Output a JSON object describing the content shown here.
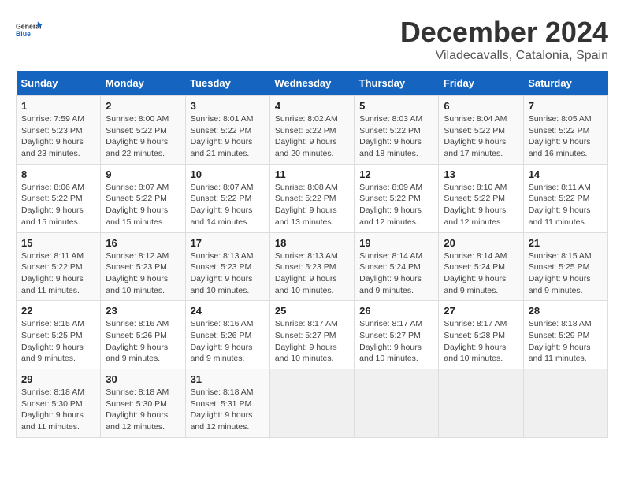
{
  "logo": {
    "line1": "General",
    "line2": "Blue"
  },
  "title": "December 2024",
  "location": "Viladecavalls, Catalonia, Spain",
  "days_of_week": [
    "Sunday",
    "Monday",
    "Tuesday",
    "Wednesday",
    "Thursday",
    "Friday",
    "Saturday"
  ],
  "weeks": [
    [
      {
        "day": "1",
        "sunrise": "Sunrise: 7:59 AM",
        "sunset": "Sunset: 5:23 PM",
        "daylight": "Daylight: 9 hours and 23 minutes."
      },
      {
        "day": "2",
        "sunrise": "Sunrise: 8:00 AM",
        "sunset": "Sunset: 5:22 PM",
        "daylight": "Daylight: 9 hours and 22 minutes."
      },
      {
        "day": "3",
        "sunrise": "Sunrise: 8:01 AM",
        "sunset": "Sunset: 5:22 PM",
        "daylight": "Daylight: 9 hours and 21 minutes."
      },
      {
        "day": "4",
        "sunrise": "Sunrise: 8:02 AM",
        "sunset": "Sunset: 5:22 PM",
        "daylight": "Daylight: 9 hours and 20 minutes."
      },
      {
        "day": "5",
        "sunrise": "Sunrise: 8:03 AM",
        "sunset": "Sunset: 5:22 PM",
        "daylight": "Daylight: 9 hours and 18 minutes."
      },
      {
        "day": "6",
        "sunrise": "Sunrise: 8:04 AM",
        "sunset": "Sunset: 5:22 PM",
        "daylight": "Daylight: 9 hours and 17 minutes."
      },
      {
        "day": "7",
        "sunrise": "Sunrise: 8:05 AM",
        "sunset": "Sunset: 5:22 PM",
        "daylight": "Daylight: 9 hours and 16 minutes."
      }
    ],
    [
      {
        "day": "8",
        "sunrise": "Sunrise: 8:06 AM",
        "sunset": "Sunset: 5:22 PM",
        "daylight": "Daylight: 9 hours and 15 minutes."
      },
      {
        "day": "9",
        "sunrise": "Sunrise: 8:07 AM",
        "sunset": "Sunset: 5:22 PM",
        "daylight": "Daylight: 9 hours and 15 minutes."
      },
      {
        "day": "10",
        "sunrise": "Sunrise: 8:07 AM",
        "sunset": "Sunset: 5:22 PM",
        "daylight": "Daylight: 9 hours and 14 minutes."
      },
      {
        "day": "11",
        "sunrise": "Sunrise: 8:08 AM",
        "sunset": "Sunset: 5:22 PM",
        "daylight": "Daylight: 9 hours and 13 minutes."
      },
      {
        "day": "12",
        "sunrise": "Sunrise: 8:09 AM",
        "sunset": "Sunset: 5:22 PM",
        "daylight": "Daylight: 9 hours and 12 minutes."
      },
      {
        "day": "13",
        "sunrise": "Sunrise: 8:10 AM",
        "sunset": "Sunset: 5:22 PM",
        "daylight": "Daylight: 9 hours and 12 minutes."
      },
      {
        "day": "14",
        "sunrise": "Sunrise: 8:11 AM",
        "sunset": "Sunset: 5:22 PM",
        "daylight": "Daylight: 9 hours and 11 minutes."
      }
    ],
    [
      {
        "day": "15",
        "sunrise": "Sunrise: 8:11 AM",
        "sunset": "Sunset: 5:22 PM",
        "daylight": "Daylight: 9 hours and 11 minutes."
      },
      {
        "day": "16",
        "sunrise": "Sunrise: 8:12 AM",
        "sunset": "Sunset: 5:23 PM",
        "daylight": "Daylight: 9 hours and 10 minutes."
      },
      {
        "day": "17",
        "sunrise": "Sunrise: 8:13 AM",
        "sunset": "Sunset: 5:23 PM",
        "daylight": "Daylight: 9 hours and 10 minutes."
      },
      {
        "day": "18",
        "sunrise": "Sunrise: 8:13 AM",
        "sunset": "Sunset: 5:23 PM",
        "daylight": "Daylight: 9 hours and 10 minutes."
      },
      {
        "day": "19",
        "sunrise": "Sunrise: 8:14 AM",
        "sunset": "Sunset: 5:24 PM",
        "daylight": "Daylight: 9 hours and 9 minutes."
      },
      {
        "day": "20",
        "sunrise": "Sunrise: 8:14 AM",
        "sunset": "Sunset: 5:24 PM",
        "daylight": "Daylight: 9 hours and 9 minutes."
      },
      {
        "day": "21",
        "sunrise": "Sunrise: 8:15 AM",
        "sunset": "Sunset: 5:25 PM",
        "daylight": "Daylight: 9 hours and 9 minutes."
      }
    ],
    [
      {
        "day": "22",
        "sunrise": "Sunrise: 8:15 AM",
        "sunset": "Sunset: 5:25 PM",
        "daylight": "Daylight: 9 hours and 9 minutes."
      },
      {
        "day": "23",
        "sunrise": "Sunrise: 8:16 AM",
        "sunset": "Sunset: 5:26 PM",
        "daylight": "Daylight: 9 hours and 9 minutes."
      },
      {
        "day": "24",
        "sunrise": "Sunrise: 8:16 AM",
        "sunset": "Sunset: 5:26 PM",
        "daylight": "Daylight: 9 hours and 9 minutes."
      },
      {
        "day": "25",
        "sunrise": "Sunrise: 8:17 AM",
        "sunset": "Sunset: 5:27 PM",
        "daylight": "Daylight: 9 hours and 10 minutes."
      },
      {
        "day": "26",
        "sunrise": "Sunrise: 8:17 AM",
        "sunset": "Sunset: 5:27 PM",
        "daylight": "Daylight: 9 hours and 10 minutes."
      },
      {
        "day": "27",
        "sunrise": "Sunrise: 8:17 AM",
        "sunset": "Sunset: 5:28 PM",
        "daylight": "Daylight: 9 hours and 10 minutes."
      },
      {
        "day": "28",
        "sunrise": "Sunrise: 8:18 AM",
        "sunset": "Sunset: 5:29 PM",
        "daylight": "Daylight: 9 hours and 11 minutes."
      }
    ],
    [
      {
        "day": "29",
        "sunrise": "Sunrise: 8:18 AM",
        "sunset": "Sunset: 5:30 PM",
        "daylight": "Daylight: 9 hours and 11 minutes."
      },
      {
        "day": "30",
        "sunrise": "Sunrise: 8:18 AM",
        "sunset": "Sunset: 5:30 PM",
        "daylight": "Daylight: 9 hours and 12 minutes."
      },
      {
        "day": "31",
        "sunrise": "Sunrise: 8:18 AM",
        "sunset": "Sunset: 5:31 PM",
        "daylight": "Daylight: 9 hours and 12 minutes."
      },
      null,
      null,
      null,
      null
    ]
  ]
}
